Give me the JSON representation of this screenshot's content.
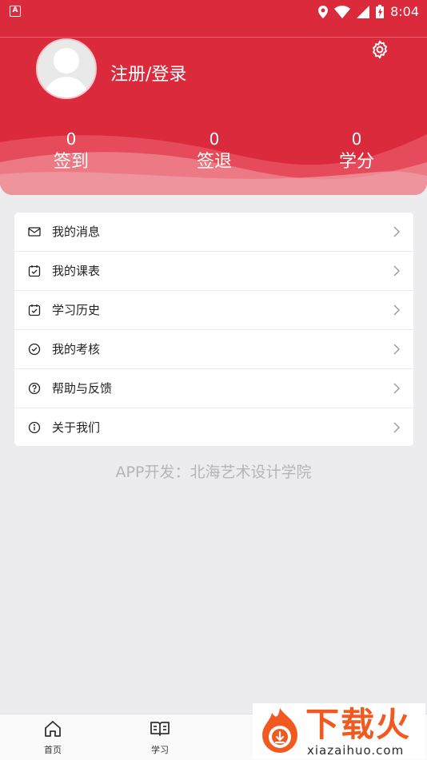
{
  "status_bar": {
    "time": "8:04"
  },
  "profile": {
    "login_label": "注册/登录"
  },
  "stats": [
    {
      "value": "0",
      "label": "签到"
    },
    {
      "value": "0",
      "label": "签退"
    },
    {
      "value": "0",
      "label": "学分"
    }
  ],
  "menu": [
    {
      "label": "我的消息",
      "icon": "mail-icon"
    },
    {
      "label": "我的课表",
      "icon": "calendar-icon"
    },
    {
      "label": "学习历史",
      "icon": "history-icon"
    },
    {
      "label": "我的考核",
      "icon": "check-circle-icon"
    },
    {
      "label": "帮助与反馈",
      "icon": "help-circle-icon"
    },
    {
      "label": "关于我们",
      "icon": "info-circle-icon"
    }
  ],
  "footer_text": "APP开发：北海艺术设计学院",
  "tabs": [
    {
      "label": "首页",
      "icon": "home-icon"
    },
    {
      "label": "学习",
      "icon": "book-icon"
    }
  ],
  "watermark": {
    "title": "下载火",
    "url": "xiazaihuo.com"
  },
  "colors": {
    "primary": "#dc2a3d",
    "background": "#ececee",
    "watermark_orange": "#f1591f"
  }
}
